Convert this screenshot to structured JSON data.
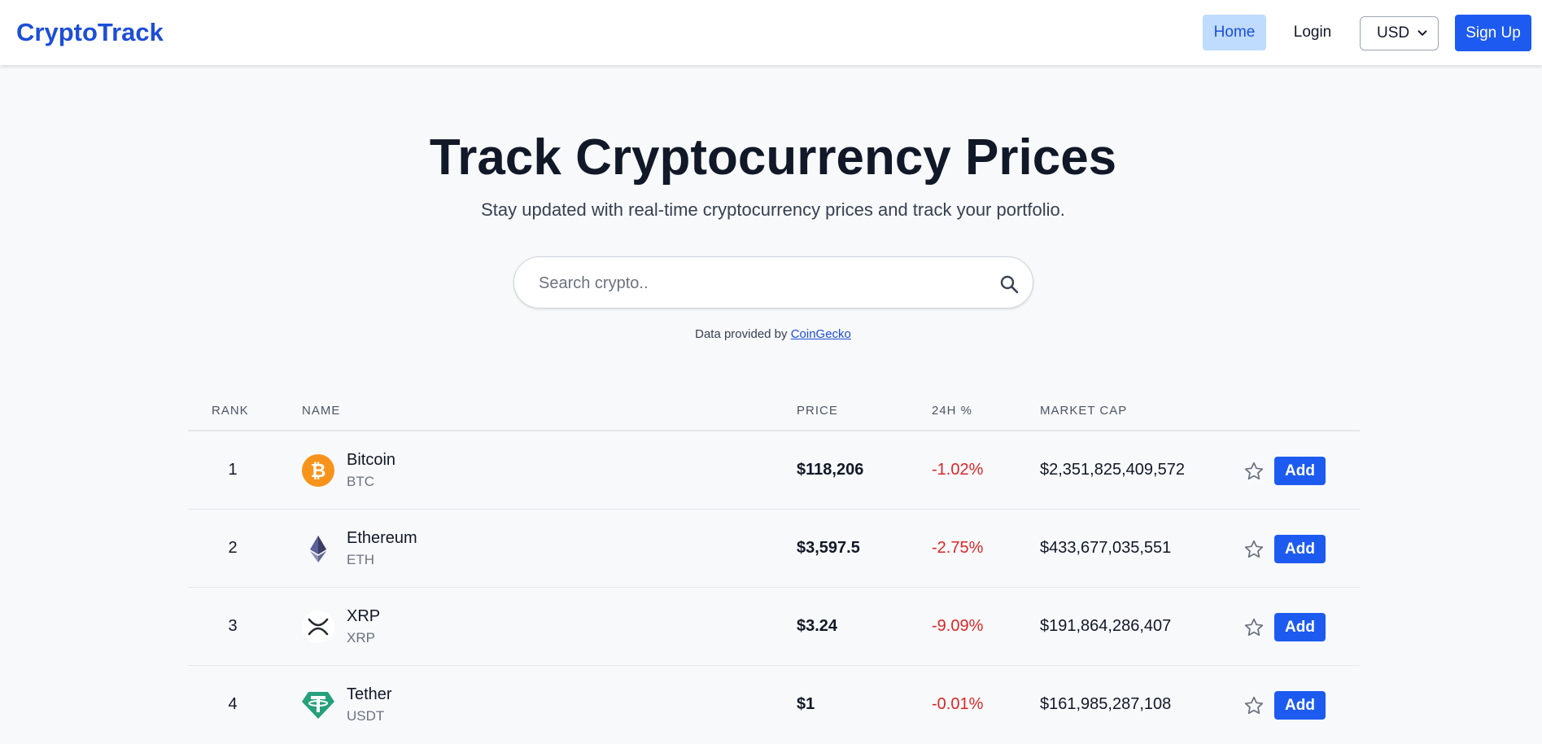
{
  "nav": {
    "brand": "CryptoTrack",
    "home": "Home",
    "login": "Login",
    "currency": "USD",
    "signup": "Sign Up"
  },
  "hero": {
    "title": "Track Cryptocurrency Prices",
    "subtitle": "Stay updated with real-time cryptocurrency prices and track your portfolio."
  },
  "search": {
    "placeholder": "Search crypto.."
  },
  "credit": {
    "prefix": "Data provided by",
    "link": "CoinGecko"
  },
  "table": {
    "headers": {
      "rank": "RANK",
      "name": "NAME",
      "price": "PRICE",
      "change": "24H %",
      "market_cap": "MARKET CAP"
    },
    "rows": [
      {
        "rank": "1",
        "name": "Bitcoin",
        "symbol": "BTC",
        "price": "$118,206",
        "change": "-1.02%",
        "market_cap": "$2,351,825,409,572",
        "add": "Add",
        "icon": "bitcoin-icon"
      },
      {
        "rank": "2",
        "name": "Ethereum",
        "symbol": "ETH",
        "price": "$3,597.5",
        "change": "-2.75%",
        "market_cap": "$433,677,035,551",
        "add": "Add",
        "icon": "ethereum-icon"
      },
      {
        "rank": "3",
        "name": "XRP",
        "symbol": "XRP",
        "price": "$3.24",
        "change": "-9.09%",
        "market_cap": "$191,864,286,407",
        "add": "Add",
        "icon": "xrp-icon"
      },
      {
        "rank": "4",
        "name": "Tether",
        "symbol": "USDT",
        "price": "$1",
        "change": "-0.01%",
        "market_cap": "$161,985,287,108",
        "add": "Add",
        "icon": "tether-icon"
      }
    ]
  },
  "colors": {
    "brand": "#1d4ed8",
    "primary_button": "#1d5bf0",
    "negative": "#dc2626",
    "bitcoin": "#f7931a",
    "tether": "#26a17b"
  }
}
